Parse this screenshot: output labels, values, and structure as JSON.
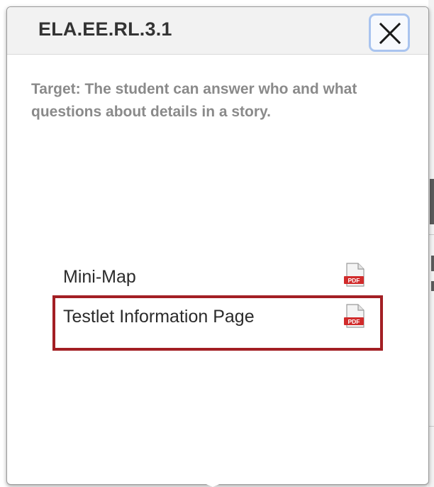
{
  "dialog": {
    "title": "ELA.EE.RL.3.1",
    "close_icon": "close-icon",
    "target_text": "Target:  The student can answer who and what questions about details in a story."
  },
  "files": [
    {
      "label": "Mini-Map",
      "icon": "pdf-icon",
      "icon_text": "PDF"
    },
    {
      "label": "Testlet Information Page",
      "icon": "pdf-icon",
      "icon_text": "PDF"
    }
  ],
  "colors": {
    "highlight_border": "#a31f24",
    "pdf_red": "#d12b2b",
    "focus_ring": "#a9c4ef"
  }
}
